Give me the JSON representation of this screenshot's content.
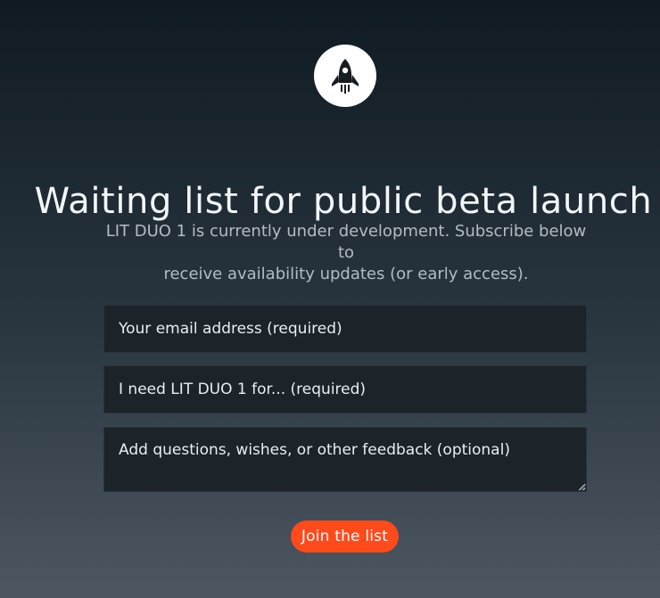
{
  "logo": {
    "icon": "rocket-icon"
  },
  "heading": {
    "title": "Waiting list for public beta launch"
  },
  "intro": {
    "line1": "LIT DUO 1 is currently under development. Subscribe below to",
    "line2": "receive availability updates (or early access)."
  },
  "form": {
    "email_placeholder": "Your email address (required)",
    "purpose_placeholder": "I need LIT DUO 1 for... (required)",
    "feedback_placeholder": "Add questions, wishes, or other feedback (optional)",
    "submit_label": "Join the list"
  },
  "colors": {
    "accent": "#ff4a1c",
    "field_bg": "#1c2329",
    "background_top": "#0f1a22",
    "background_bottom": "#4c5761"
  }
}
